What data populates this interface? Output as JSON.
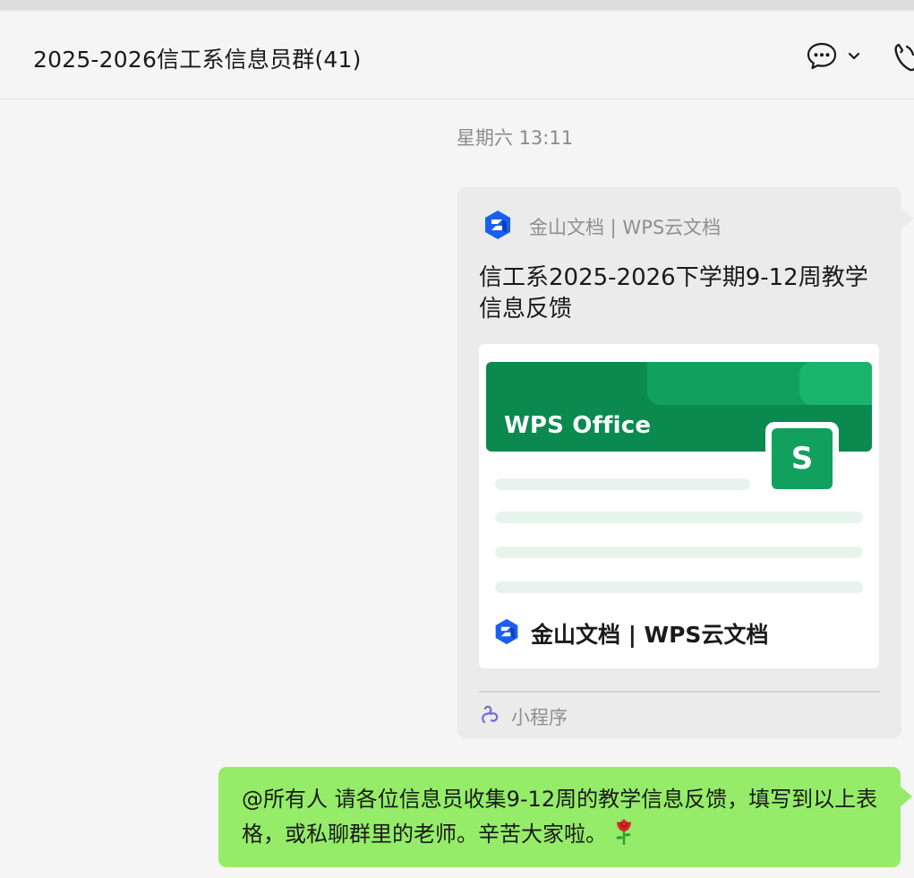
{
  "header": {
    "chat_title": "2025-2026信工系信息员群(41)",
    "icons": [
      "chat-more-icon",
      "chevron-down-icon",
      "voice-call-icon"
    ]
  },
  "messages": {
    "timestamp": "星期六 13:11",
    "card": {
      "source_name": "金山文档 | WPS云文档",
      "title": "信工系2025-2026下学期9-12周教学信息反馈",
      "preview_banner_text": "WPS Office",
      "preview_badge_letter": "S",
      "preview_footer_text": "金山文档 | WPS云文档",
      "kind_label": "小程序"
    },
    "text_bubble": {
      "text": "@所有人 请各位信息员收集9-12周的教学信息反馈，填写到以上表格，或私聊群里的老师。辛苦大家啦。",
      "emoji": "rose-icon"
    }
  },
  "colors": {
    "bubble_green": "#95ec69",
    "wps_green": "#0b8a4f",
    "wps_blue": "#1a5ff0",
    "link_purple": "#6f6ce0"
  }
}
